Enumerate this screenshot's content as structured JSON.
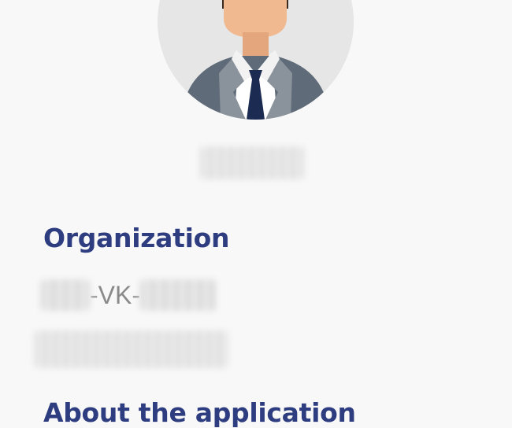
{
  "profile": {
    "name_redacted": true
  },
  "organization": {
    "title": "Organization",
    "id_left_redacted": true,
    "id_separator_left": "-",
    "id_visible": "VK",
    "id_separator_right": "-",
    "id_right_redacted": true,
    "name_redacted": true
  },
  "about": {
    "title": "About the application"
  },
  "icons": {
    "avatar": "user-avatar-icon"
  },
  "colors": {
    "heading": "#2e3d80",
    "background": "#f8f8f8",
    "avatar_bg": "#e6e6e6",
    "suit": "#5f6b78",
    "tie": "#1c2b52",
    "skin": "#f0b98f"
  }
}
